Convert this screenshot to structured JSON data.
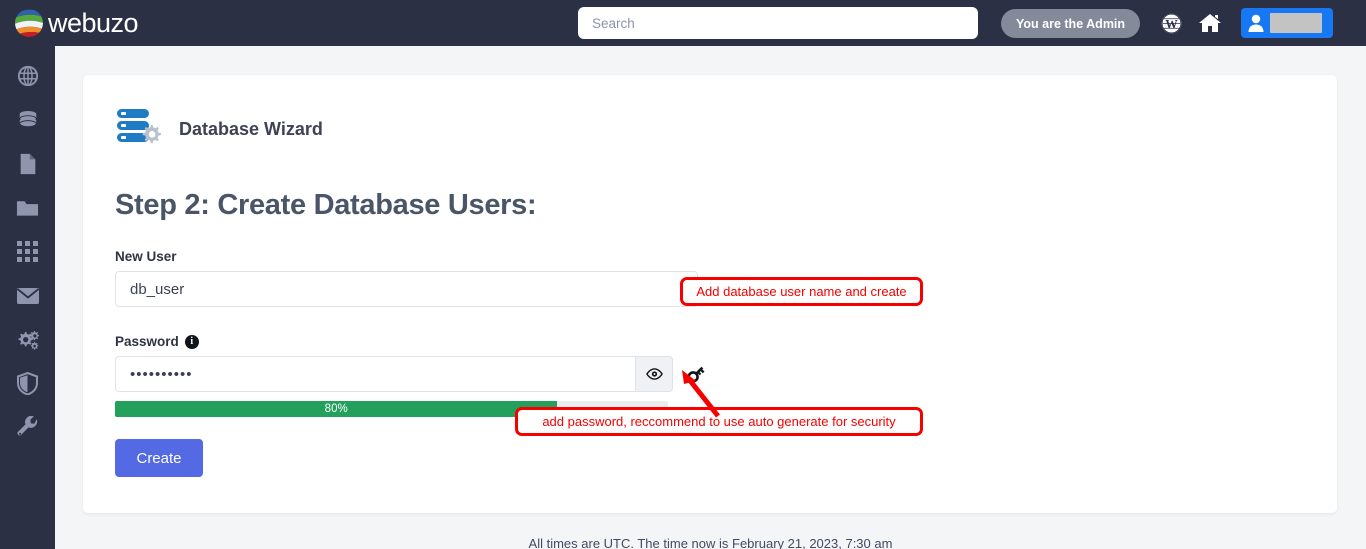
{
  "header": {
    "logo_text": "webuzo",
    "search_placeholder": "Search",
    "admin_badge": "You are the Admin",
    "icons": [
      "wordpress-icon",
      "home-icon",
      "user-icon"
    ]
  },
  "sidebar": {
    "items": [
      {
        "icon": "globe-icon",
        "name": "sidebar-item-domains"
      },
      {
        "icon": "database-icon",
        "name": "sidebar-item-databases"
      },
      {
        "icon": "file-icon",
        "name": "sidebar-item-files"
      },
      {
        "icon": "folder-icon",
        "name": "sidebar-item-folders"
      },
      {
        "icon": "grid-icon",
        "name": "sidebar-item-apps"
      },
      {
        "icon": "envelope-icon",
        "name": "sidebar-item-email"
      },
      {
        "icon": "gears-icon",
        "name": "sidebar-item-settings"
      },
      {
        "icon": "shield-icon",
        "name": "sidebar-item-security"
      },
      {
        "icon": "wrench-icon",
        "name": "sidebar-item-tools"
      }
    ]
  },
  "main": {
    "wizard_title": "Database Wizard",
    "wizard_icon": "database-server-gear-icon",
    "step_title": "Step 2: Create Database Users:",
    "new_user": {
      "label": "New User",
      "value": "db_user"
    },
    "password": {
      "label": "Password",
      "info_icon": "info-icon",
      "value": "••••••••••",
      "toggle_icon": "eye-icon",
      "generate_icon": "key-icon"
    },
    "strength": {
      "percent_label": "80%",
      "percent": 80,
      "color": "#22a05c"
    },
    "create_label": "Create"
  },
  "annotations": [
    {
      "id": "annot-user",
      "text": "Add database user name and create",
      "color": "#f60000"
    },
    {
      "id": "annot-pass",
      "text": "add password, reccommend to use auto generate for security",
      "color": "#f60000"
    }
  ],
  "footer": {
    "text": "All times are UTC. The time now is February 21, 2023, 7:30 am"
  }
}
